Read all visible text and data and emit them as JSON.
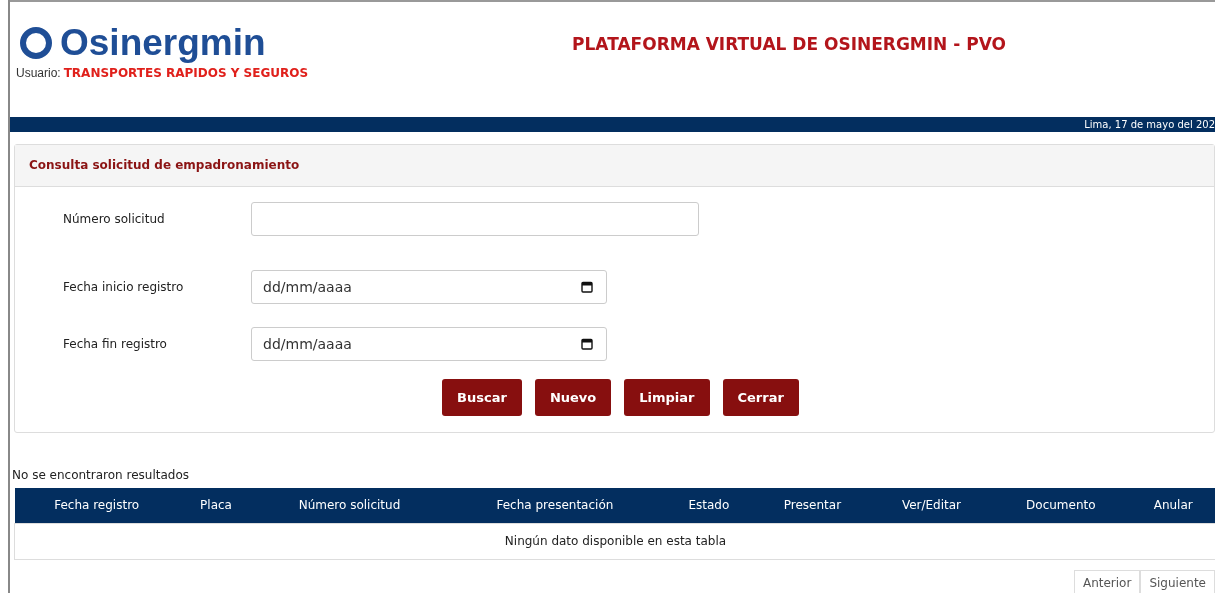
{
  "header": {
    "logo_text": "Osinergmin",
    "user_label": "Usuario:",
    "user_name": "TRANSPORTES RAPIDOS Y SEGUROS",
    "title": "PLATAFORMA VIRTUAL DE OSINERGMIN - PVO"
  },
  "date_bar": "Lima, 17 de mayo del 202",
  "form": {
    "title": "Consulta solicitud de empadronamiento",
    "fields": [
      {
        "label": "Número solicitud",
        "kind": "text"
      },
      {
        "label": "Fecha inicio registro",
        "kind": "date",
        "placeholder": "dd/mm/aaaa"
      },
      {
        "label": "Fecha fin registro",
        "kind": "date",
        "placeholder": "dd/mm/aaaa"
      }
    ],
    "buttons": [
      "Buscar",
      "Nuevo",
      "Limpiar",
      "Cerrar"
    ]
  },
  "results_message": "No se encontraron resultados",
  "table": {
    "columns": [
      "Fecha registro",
      "Placa",
      "Número solicitud",
      "Fecha presentación",
      "Estado",
      "Presentar",
      "Ver/Editar",
      "Documento",
      "Anular"
    ],
    "empty_message": "Ningún dato disponible en esta tabla"
  },
  "pagination": [
    "Anterior",
    "Siguiente"
  ]
}
